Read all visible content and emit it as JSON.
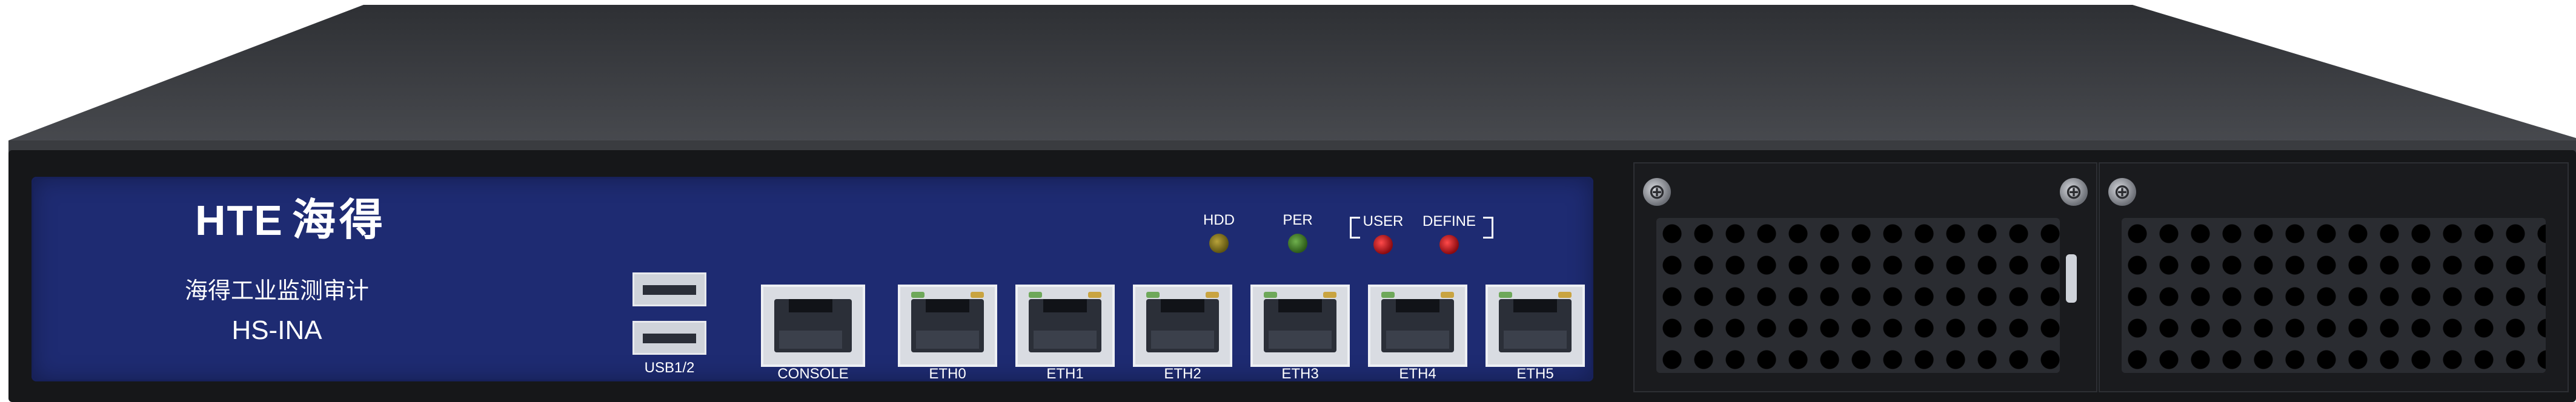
{
  "brand": {
    "logo_mark": "HTE",
    "logo_cn": "海得",
    "product_name": "海得工业监测审计",
    "model": "HS-INA"
  },
  "leds": [
    {
      "label": "HDD",
      "color": "#b8a23a"
    },
    {
      "label": "PER",
      "color": "#6fb04d"
    },
    {
      "label": "USER",
      "color": "#ff4a4a"
    },
    {
      "label": "DEFINE",
      "color": "#ff4a4a"
    }
  ],
  "ports": {
    "usb_label": "USB1/2",
    "console_label": "CONSOLE",
    "eth": [
      "ETH0",
      "ETH1",
      "ETH2",
      "ETH3",
      "ETH4",
      "ETH5"
    ]
  },
  "colors": {
    "panel": "#1e2b72",
    "chassis": "#161719"
  }
}
